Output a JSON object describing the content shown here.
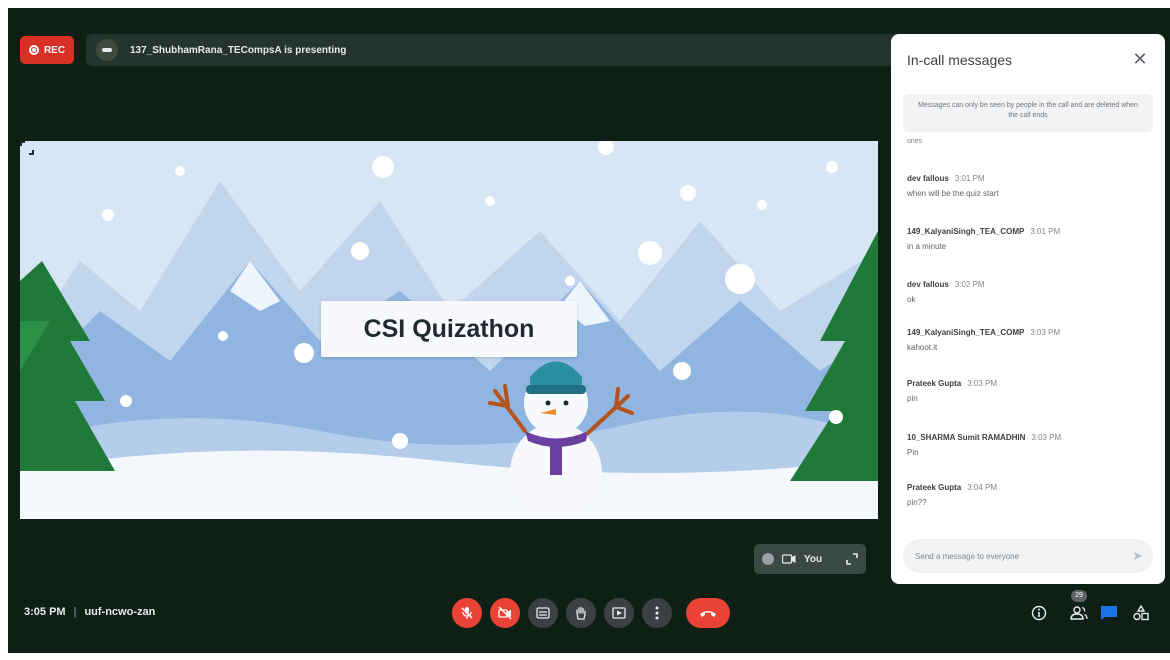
{
  "recording": {
    "label": "REC"
  },
  "presenter_banner": {
    "text": "137_ShubhamRana_TECompsA is presenting"
  },
  "slide": {
    "title": "CSI Quizathon"
  },
  "self_tile": {
    "label": "You"
  },
  "chat": {
    "title": "In-call messages",
    "close_icon": "close-icon",
    "notice": "Messages can only be seen by people in the call and are deleted when the call ends",
    "cut_text": "ones",
    "messages": [
      {
        "sender": "dev fallous",
        "time": "3:01 PM",
        "text": "when will be the quiz start"
      },
      {
        "sender": "149_KalyaniSingh_TEA_COMP",
        "time": "3:01 PM",
        "text": "in a minute"
      },
      {
        "sender": "dev fallous",
        "time": "3:02 PM",
        "text": "ok"
      },
      {
        "sender": "149_KalyaniSingh_TEA_COMP",
        "time": "3:03 PM",
        "text": "kahoot.it"
      },
      {
        "sender": "Prateek Gupta",
        "time": "3:03 PM",
        "text": "pin"
      },
      {
        "sender": "10_SHARMA Sumit RAMADHIN",
        "time": "3:03 PM",
        "text": "Pin"
      },
      {
        "sender": "Prateek Gupta",
        "time": "3:04 PM",
        "text": "pin??"
      }
    ],
    "input_placeholder": "Send a message to everyone"
  },
  "footer": {
    "time": "3:05 PM",
    "separator": "|",
    "meeting_code": "uuf-ncwo-zan"
  },
  "people_count": "29",
  "colors": {
    "background": "#0e1f16",
    "danger": "#ea4335",
    "accent": "#1a73e8",
    "panel": "#ffffff"
  },
  "controls": [
    {
      "name": "microphone-off-button",
      "icon": "mic-off-icon"
    },
    {
      "name": "camera-off-button",
      "icon": "camera-off-icon"
    },
    {
      "name": "captions-button",
      "icon": "captions-icon"
    },
    {
      "name": "raise-hand-button",
      "icon": "hand-icon"
    },
    {
      "name": "present-button",
      "icon": "present-icon"
    },
    {
      "name": "more-options-button",
      "icon": "more-vert-icon"
    },
    {
      "name": "leave-call-button",
      "icon": "end-call-icon"
    }
  ]
}
